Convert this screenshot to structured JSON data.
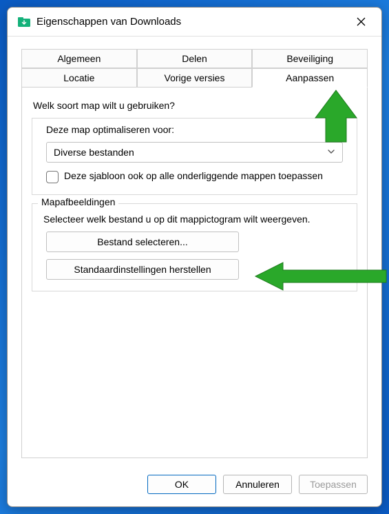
{
  "window": {
    "title": "Eigenschappen van Downloads"
  },
  "tabs": {
    "row1": [
      "Algemeen",
      "Delen",
      "Beveiliging"
    ],
    "row2": [
      "Locatie",
      "Vorige versies",
      "Aanpassen"
    ],
    "active": "Aanpassen"
  },
  "panel": {
    "question": "Welk soort map wilt u gebruiken?",
    "optimize_label": "Deze map optimaliseren voor:",
    "select_value": "Diverse bestanden",
    "checkbox_label": "Deze sjabloon ook op alle onderliggende mappen toepassen"
  },
  "images_group": {
    "label": "Mapafbeeldingen",
    "desc": "Selecteer welk bestand u op dit mappictogram wilt weergeven.",
    "select_file": "Bestand selecteren...",
    "restore_defaults": "Standaardinstellingen herstellen"
  },
  "footer": {
    "ok": "OK",
    "cancel": "Annuleren",
    "apply": "Toepassen"
  }
}
